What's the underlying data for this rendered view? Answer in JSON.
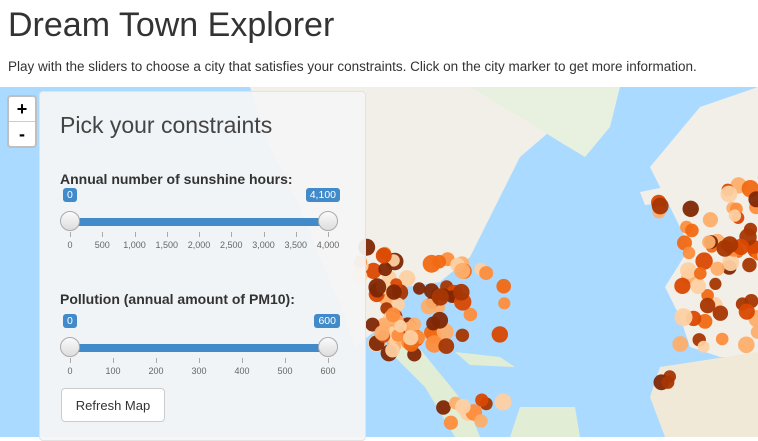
{
  "header": {
    "title": "Dream Town Explorer",
    "subtitle": "Play with the sliders to choose a city that satisfies your constraints. Click on the city marker to get more information."
  },
  "zoom": {
    "in_label": "+",
    "out_label": "-"
  },
  "panel": {
    "title": "Pick your constraints",
    "sunshine": {
      "label": "Annual number of sunshine hours:",
      "min_value": "0",
      "max_value": "4,100",
      "low": 0,
      "high": 4100,
      "range": [
        0,
        4000
      ],
      "ticks": [
        "0",
        "500",
        "1,000",
        "1,500",
        "2,000",
        "2,500",
        "3,000",
        "3,500",
        "4,000"
      ]
    },
    "pollution": {
      "label": "Pollution (annual amount of PM10):",
      "min_value": "0",
      "max_value": "600",
      "low": 0,
      "high": 600,
      "range": [
        0,
        600
      ],
      "ticks": [
        "0",
        "100",
        "200",
        "300",
        "400",
        "500",
        "600"
      ]
    },
    "refresh_label": "Refresh Map"
  },
  "map": {
    "water_color": "#aadaff",
    "land_color": "#f2efe9",
    "marker_colors": [
      "#fdd0a2",
      "#fdae6b",
      "#fd8d3c",
      "#f16913",
      "#d94801",
      "#a63603",
      "#7f2704"
    ]
  }
}
